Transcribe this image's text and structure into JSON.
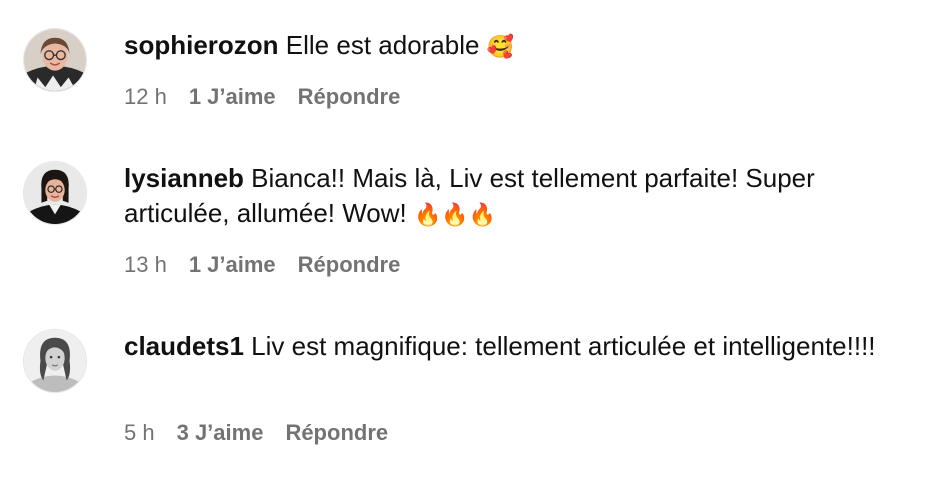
{
  "comments": [
    {
      "username": "sophierozon",
      "text": " Elle est adorable ",
      "emoji": "🥰",
      "time": "12 h",
      "likes": "1 J’aime",
      "reply": "Répondre",
      "avatar_icon": "woman-with-glasses-avatar"
    },
    {
      "username": "lysianneb",
      "text": " Bianca!! Mais là, Liv est tellement parfaite! Super articulée, allumée! Wow! ",
      "emoji": "🔥🔥🔥",
      "time": "13 h",
      "likes": "1 J’aime",
      "reply": "Répondre",
      "avatar_icon": "woman-dark-hair-avatar"
    },
    {
      "username": "claudets1",
      "text": " Liv est magnifique: tellement articulée et intelligente!!!!",
      "emoji": "",
      "time": "5 h",
      "likes": "3 J’aime",
      "reply": "Répondre",
      "avatar_icon": "woman-grayscale-avatar"
    }
  ],
  "colors": {
    "text": "#111111",
    "meta": "#737373",
    "background": "#ffffff",
    "emoji_fire": "#f4511e"
  }
}
